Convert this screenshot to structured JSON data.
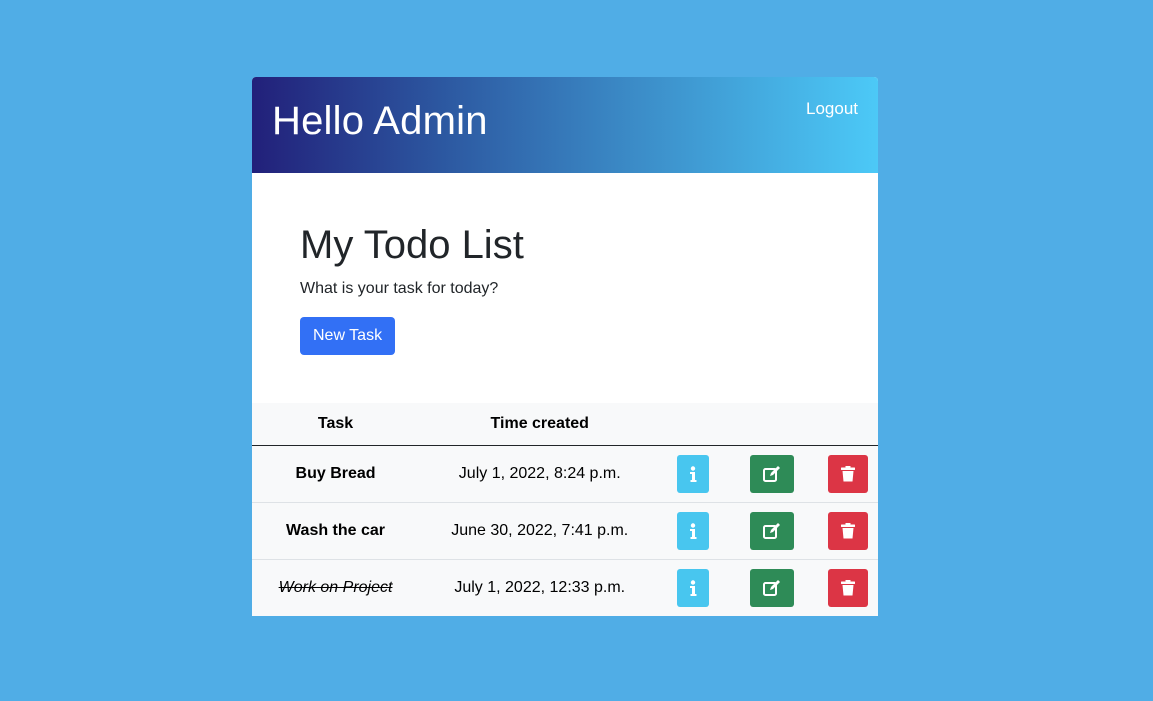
{
  "header": {
    "greeting": "Hello Admin",
    "logout_label": "Logout"
  },
  "hero": {
    "title": "My Todo List",
    "subtitle": "What is your task for today?",
    "new_task_label": "New Task"
  },
  "table": {
    "headers": [
      "Task",
      "Time created"
    ],
    "rows": [
      {
        "task": "Buy Bread",
        "time": "July 1, 2022, 8:24 p.m.",
        "done": false
      },
      {
        "task": "Wash the car",
        "time": "June 30, 2022, 7:41 p.m.",
        "done": false
      },
      {
        "task": "Work on Project",
        "time": "July 1, 2022, 12:33 p.m.",
        "done": true
      }
    ]
  },
  "icons": {
    "info": "info-icon",
    "edit": "edit-icon",
    "delete": "trash-icon"
  },
  "colors": {
    "background": "#50ade6",
    "primary": "#3270f5",
    "info": "#48c6ef",
    "success": "#2e8b57",
    "danger": "#dc3545"
  }
}
